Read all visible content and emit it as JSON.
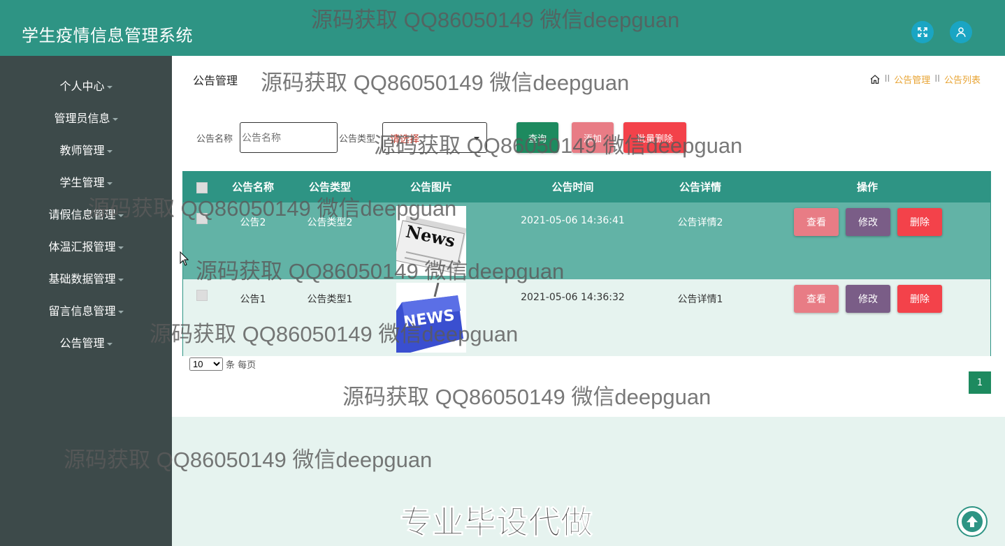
{
  "header": {
    "title": "学生疫情信息管理系统"
  },
  "sidebar": {
    "items": [
      {
        "label": "个人中心"
      },
      {
        "label": "管理员信息"
      },
      {
        "label": "教师管理"
      },
      {
        "label": "学生管理"
      },
      {
        "label": "请假信息管理"
      },
      {
        "label": "体温汇报管理"
      },
      {
        "label": "基础数据管理"
      },
      {
        "label": "留言信息管理"
      },
      {
        "label": "公告管理"
      }
    ]
  },
  "page": {
    "title": "公告管理",
    "breadcrumb": {
      "sep": "II",
      "items": [
        "公告管理",
        "公告列表"
      ]
    }
  },
  "filters": {
    "name_label": "公告名称",
    "name_placeholder": "公告名称",
    "type_label": "公告类型",
    "type_value": "请选择",
    "query_button": "查询",
    "add_button": "添加",
    "batch_delete_button": "批量删除"
  },
  "table": {
    "columns": [
      "公告名称",
      "公告类型",
      "公告图片",
      "公告时间",
      "公告详情",
      "操作"
    ],
    "rows": [
      {
        "name": "公告2",
        "type": "公告类型2",
        "image": "News",
        "time": "2021-05-06 14:36:41",
        "detail": "公告详情2"
      },
      {
        "name": "公告1",
        "type": "公告类型1",
        "image": "NEWS",
        "time": "2021-05-06 14:36:32",
        "detail": "公告详情1"
      }
    ],
    "actions": {
      "view": "查看",
      "edit": "修改",
      "delete": "删除"
    }
  },
  "pagination": {
    "page_size": "10",
    "page_size_suffix": "条 每页",
    "current_page": "1"
  },
  "watermarks": {
    "text": "源码获取 QQ86050149 微信deepguan",
    "banner": "专业毕设代做"
  },
  "colors": {
    "header": "#2e9484",
    "sidebar": "#3d4a4a",
    "accent_orange": "#e8a434"
  },
  "icons": {
    "fullscreen": "expand-icon",
    "user": "user-icon",
    "home": "home-icon",
    "back_to_top": "arrow-up-icon"
  }
}
